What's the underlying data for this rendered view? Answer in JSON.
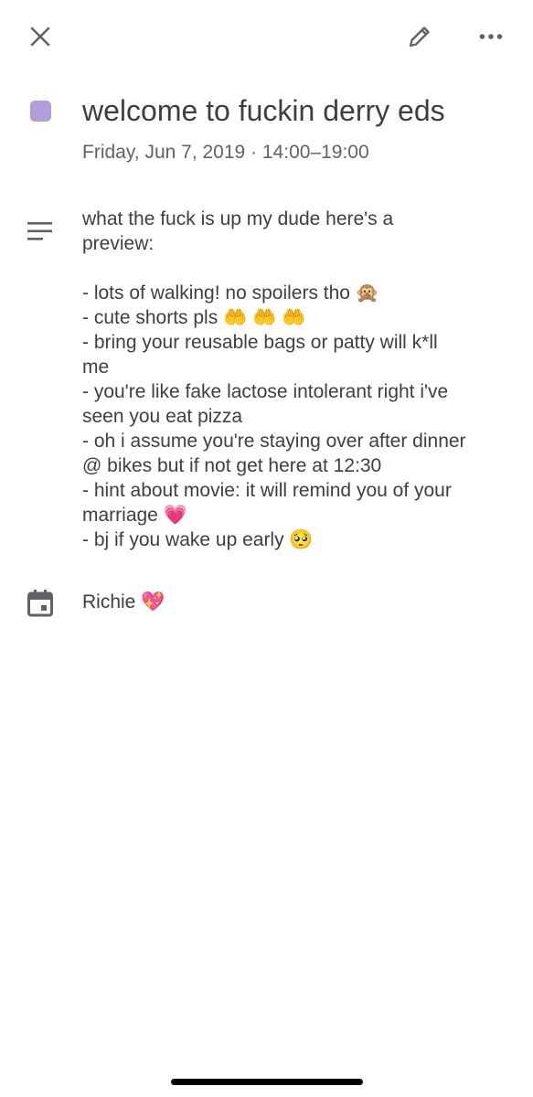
{
  "toolbar": {
    "close_icon": "close-icon",
    "edit_icon": "pencil-icon",
    "more_icon": "more-horizontal-icon"
  },
  "event": {
    "color": "#b39ddb",
    "title": "welcome to fuckin derry eds",
    "when": "Friday, Jun 7, 2019 · 14:00–19:00",
    "description_lines": [
      "what the fuck is up my dude here's a",
      "preview:",
      "",
      "- lots of walking! no spoilers tho 🙊",
      "- cute shorts pls 🤲 🤲 🤲",
      "- bring your reusable bags or patty will k*ll",
      "me",
      "- you're like fake lactose intolerant right i've",
      "seen you eat pizza",
      "- oh i assume you're staying over after dinner",
      "@ bikes but if not get here at 12:30",
      "- hint about movie: it will remind you of your",
      "marriage 💗",
      "- bj if you wake up early 🥺"
    ],
    "calendar_name": "Richie 💖"
  }
}
